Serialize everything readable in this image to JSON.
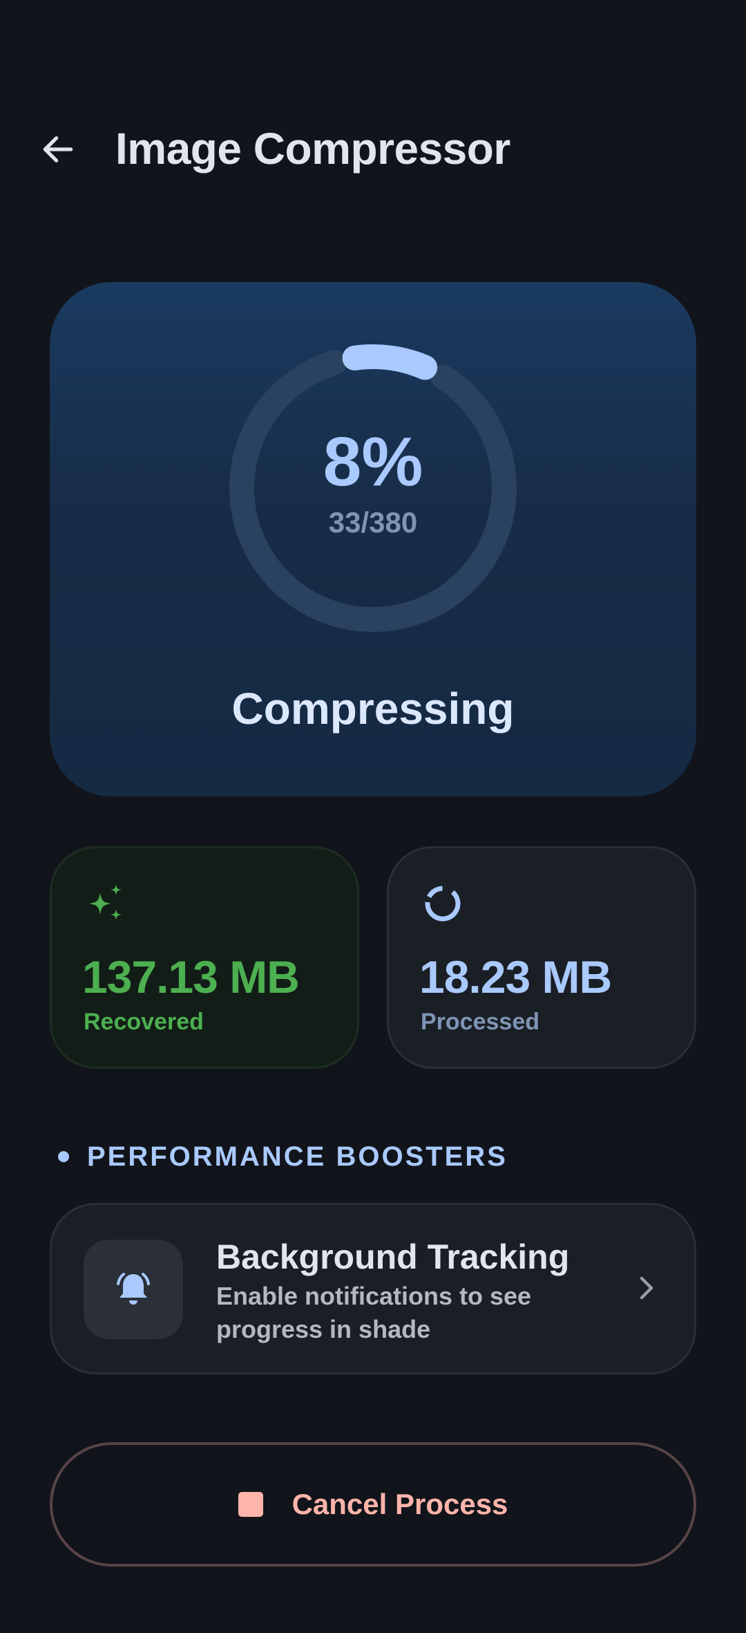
{
  "header": {
    "title": "Image Compressor",
    "back_icon": "arrow-left-icon"
  },
  "progress": {
    "percent_label": "8%",
    "count_label": "33/380",
    "fraction": 0.087,
    "status": "Compressing",
    "colors": {
      "track": "#2a4260",
      "fill": "#a9c9ff"
    }
  },
  "stats": {
    "recovered": {
      "value": "137.13 MB",
      "label": "Recovered",
      "icon": "sparkles-icon",
      "color": "#4caf50"
    },
    "processed": {
      "value": "18.23 MB",
      "label": "Processed",
      "icon": "progress-spinner-icon",
      "color": "#a9c9ff"
    }
  },
  "performance": {
    "section_title": "PERFORMANCE BOOSTERS",
    "items": [
      {
        "title": "Background Tracking",
        "description": "Enable notifications to see progress in shade",
        "icon": "bell-ringing-icon"
      }
    ]
  },
  "actions": {
    "cancel_label": "Cancel Process",
    "cancel_icon": "stop-icon",
    "cancel_color": "#ffb4ab"
  }
}
